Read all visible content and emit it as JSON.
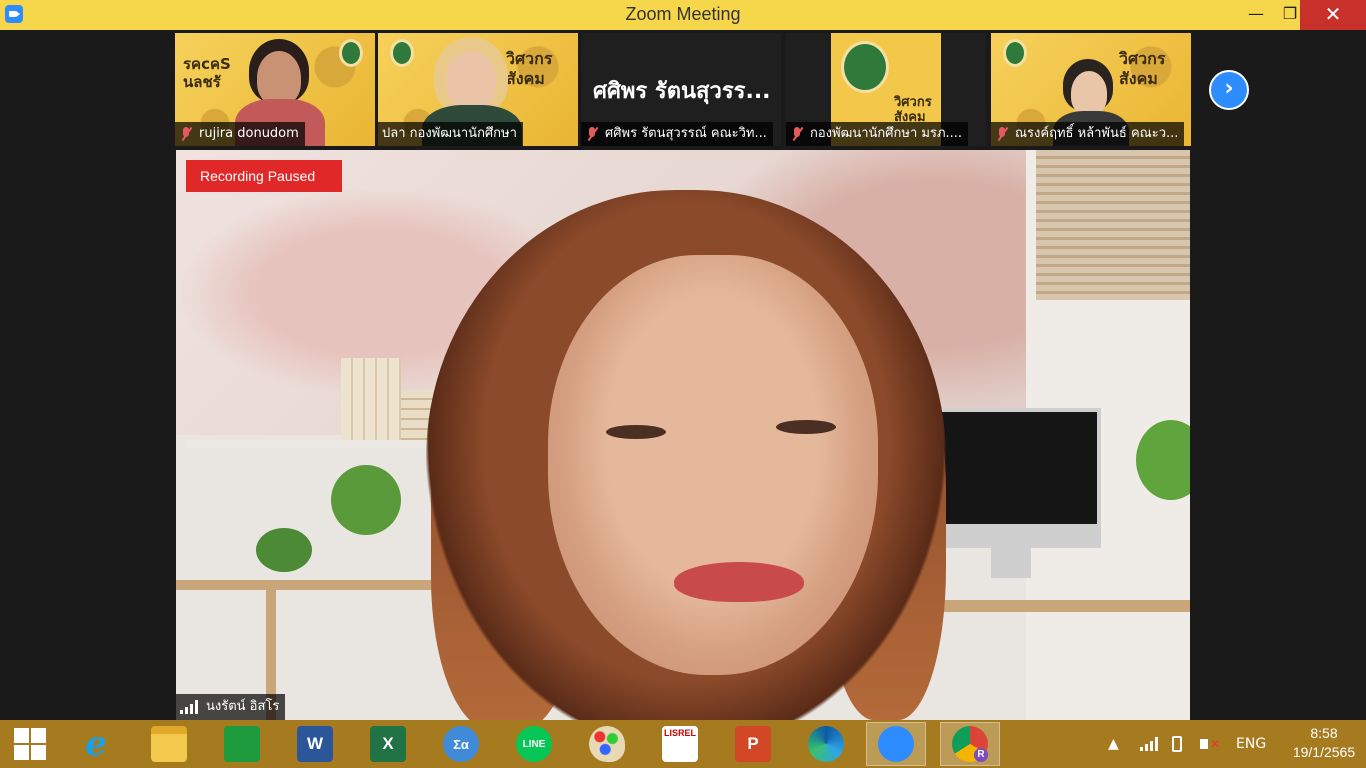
{
  "window": {
    "title": "Zoom Meeting",
    "minimize_glyph": "—",
    "maximize_glyph": "❐",
    "close_glyph": "✕"
  },
  "recording": {
    "status": "Recording Paused"
  },
  "participants": [
    {
      "name": "rujira donudom",
      "muted": true,
      "poster_text": "รคcคS นลชรั"
    },
    {
      "name": "ปลา กองพัฒนานักศึกษา",
      "muted": true,
      "poster_text": "วิศวกร สังคม"
    },
    {
      "name": "ศศิพร รัตนสุวรรณ์ คณะวิท...",
      "muted": true,
      "display_name": "ศศิพร รัตนสุวรร..."
    },
    {
      "name": "กองพัฒนานักศึกษา มรภ....",
      "muted": true,
      "poster_text": "วิศวกร สังคม"
    },
    {
      "name": "ณรงค์ฤทธิ์ หล้าพันธ์ คณะว...",
      "muted": true,
      "poster_text": "วิศวกร สังคม"
    }
  ],
  "next_page_glyph": "›",
  "active_speaker": {
    "name": "นงรัตน์ อิสโร"
  },
  "taskbar": {
    "items": [
      {
        "name": "start-button",
        "label": ""
      },
      {
        "name": "internet-explorer",
        "label": "e"
      },
      {
        "name": "file-explorer",
        "label": ""
      },
      {
        "name": "store",
        "label": ""
      },
      {
        "name": "word",
        "label": "W"
      },
      {
        "name": "excel",
        "label": "X"
      },
      {
        "name": "math-input",
        "label": "Σα"
      },
      {
        "name": "line",
        "label": "LINE"
      },
      {
        "name": "paint",
        "label": ""
      },
      {
        "name": "lisrel",
        "label": "LISREL"
      },
      {
        "name": "powerpoint",
        "label": "P"
      },
      {
        "name": "edge",
        "label": ""
      },
      {
        "name": "zoom",
        "label": ""
      },
      {
        "name": "chrome",
        "label": "R"
      }
    ],
    "tray": {
      "language": "ENG",
      "time": "8:58",
      "date": "19/1/2565",
      "show_hidden_glyph": "▲"
    }
  },
  "colors": {
    "titlebar": "#f6d64a",
    "recording": "#e02828",
    "taskbar": "#a67a1e",
    "zoom_blue": "#2d8cff"
  }
}
